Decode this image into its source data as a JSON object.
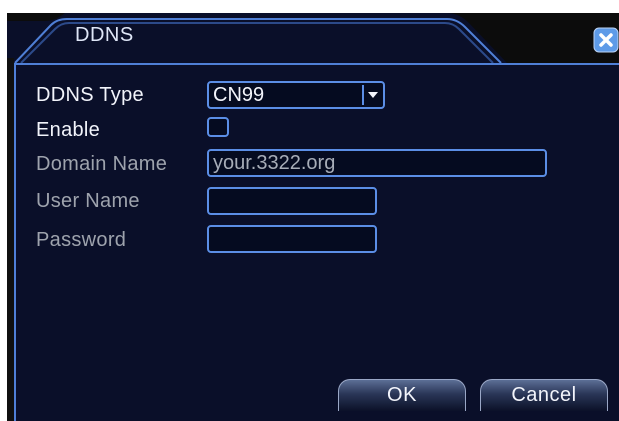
{
  "dialog": {
    "title": "DDNS"
  },
  "form": {
    "ddns_type": {
      "label": "DDNS Type",
      "value": "CN99"
    },
    "enable": {
      "label": "Enable",
      "checked": false
    },
    "domain_name": {
      "label": "Domain Name",
      "value": "your.3322.org"
    },
    "user_name": {
      "label": "User Name",
      "value": ""
    },
    "password": {
      "label": "Password",
      "value": ""
    }
  },
  "buttons": {
    "ok_label": "OK",
    "cancel_label": "Cancel"
  },
  "icons": {
    "close": "close-icon",
    "dropdown": "chevron-down-icon"
  },
  "colors": {
    "panel_background": "#0a0f29",
    "field_border": "#5b8ee6",
    "close_button": "#5e9be8"
  }
}
